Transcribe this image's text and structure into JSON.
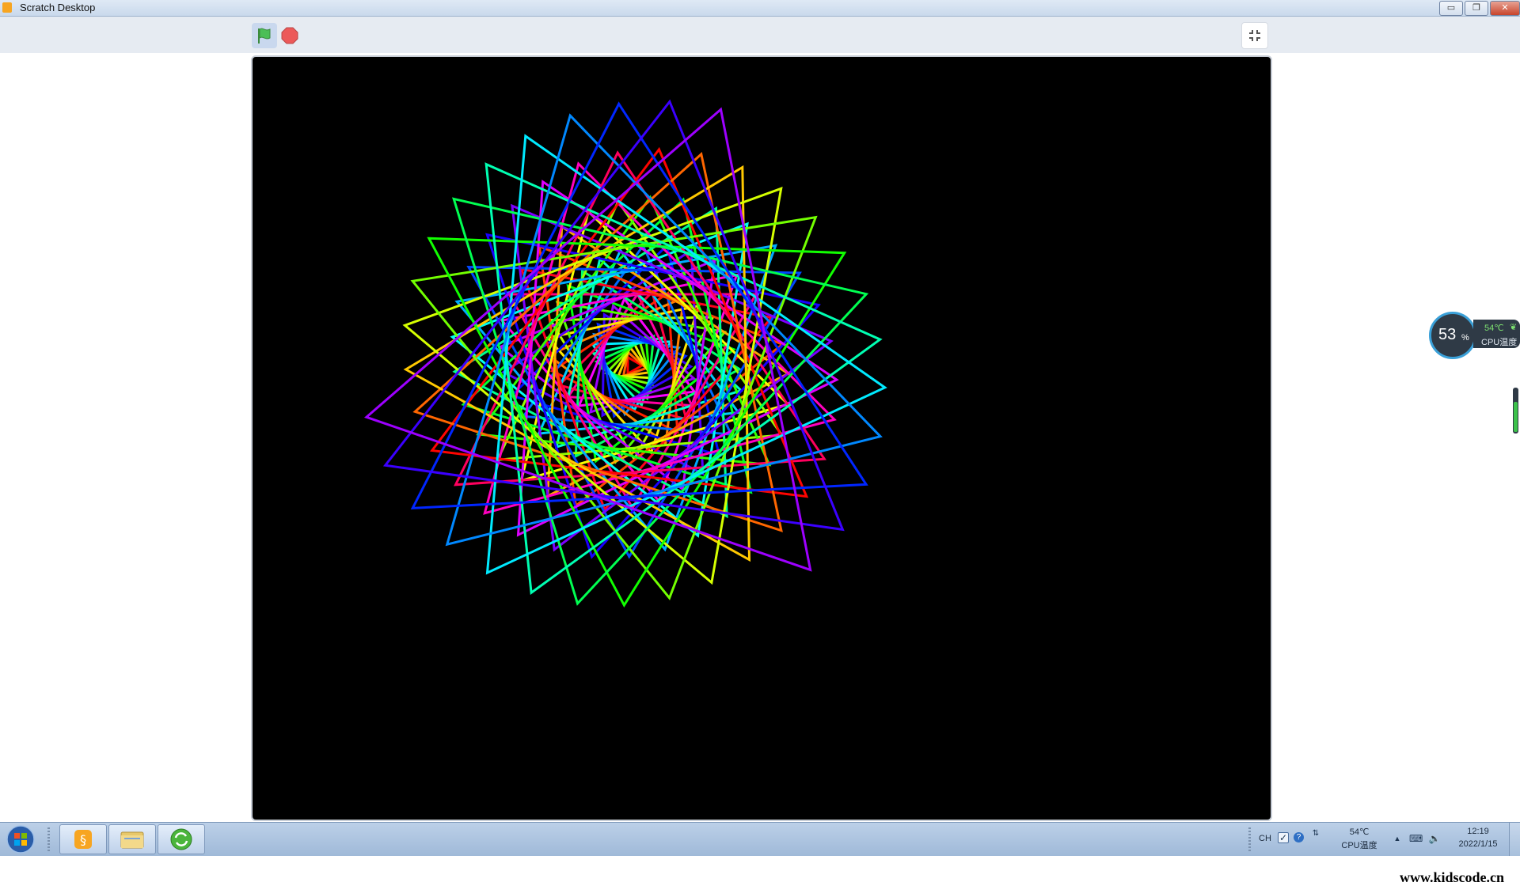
{
  "window": {
    "title": "Scratch Desktop",
    "minimize_label": "▭",
    "restore_label": "❐",
    "close_label": "✕"
  },
  "toolbar": {
    "green_flag_icon": "green-flag-icon",
    "stop_icon": "stop-icon",
    "fullscreen_icon": "exit-fullscreen-icon"
  },
  "stage": {
    "background": "#000000"
  },
  "cpu_monitor": {
    "percent": "53",
    "percent_symbol": "%",
    "temperature": "54℃",
    "label": "CPU温度"
  },
  "taskbar": {
    "tray": {
      "ime": "CH",
      "temperature": "54℃",
      "temperature_label": "CPU温度",
      "time": "12:19",
      "date": "2022/1/15"
    }
  },
  "watermark": "www.kidscode.cn"
}
